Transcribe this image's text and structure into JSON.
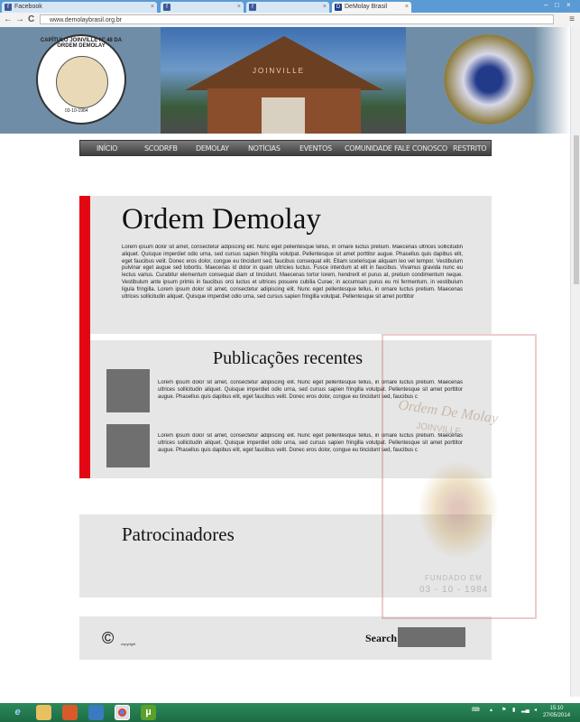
{
  "browser": {
    "tabs": [
      {
        "label": "Facebook",
        "favicon": "f"
      },
      {
        "label": "",
        "favicon": "f"
      },
      {
        "label": "",
        "favicon": "f"
      },
      {
        "label": "DeMolay Brasil",
        "favicon": "D"
      }
    ],
    "url": "www.demolaybrasil.org.br",
    "back": "←",
    "forward": "→",
    "reload": "C",
    "menu": "≡",
    "min": "–",
    "max": "□",
    "close": "×"
  },
  "banner": {
    "seal_text": "CAPÍTULO JOINVILLE Nº 48 DA ORDEM DEMOLAY",
    "seal_date": "03-10-1984",
    "gate_sign": "JOINVILLE"
  },
  "nav": {
    "items": [
      "INÍCIO",
      "SCODRFB",
      "DEMOLAY",
      "NOTÍCIAS",
      "EVENTOS",
      "COMUNIDADE",
      "FALE CONOSCO",
      "RESTRITO"
    ]
  },
  "main": {
    "title": "Ordem Demolay",
    "body": "Lorem ipsum dolor sit amet, consectetur adipiscing elit. Nunc eget pellentesque tellus, in ornare luctus pretium. Maecenas ultrices sollicitudin aliquet. Quisque imperdiet odio urna, sed cursus sapien fringilla volutpat. Pellentesque sit amet porttitor augue. Phasellus quis dapibus elit, eget faucibus velit. Donec eros dolor, congue eu tincidunt sed, faucibus consequat elit. Etiam scelerisque aliquam leo vel tempor. Vestibulum pulvinar eget augue sed lobortis. Maecenas id dolor in quam ultricies luctus. Fusce interdum at elit in faucibus. Vivamus gravida nunc eu lectus varius. Curabitur elementum consequat diam ut tincidunt. Maecenas tortor lorem, hendrerit et purus at, pretium condimentum neque. Vestibulum ante ipsum primis in faucibus orci luctus et ultrices posuere cubilia Curae; in accumsan purus eu mi fermentum, in vestibulum ligula fringilla. Lorem ipsum dolor sit amet, consectetur adipiscing elit. Nunc eget pellentesque tellus, in ornare luctus pretium. Maecenas ultrices sollicitudin aliquet. Quisque imperdiet odio urna, sed cursus sapien fringilla volutpat. Pellentesque sit amet porttitor"
  },
  "recent": {
    "title": "Publicações recentes",
    "posts": [
      {
        "text": "Lorem ipsum dolor sit amet, consectetur adipiscing elit. Nunc eget pellentesque tellus, in ornare luctus pretium. Maecenas ultrices sollicitudin aliquet. Quisque imperdiet odio urna, sed cursus sapien fringilla volutpat. Pellentesque sit amet porttitor augue. Phasellus quis dapibus elit, eget faucibus velit. Donec eros dolor, congue eu tincidunt sed, faucibus c"
      },
      {
        "text": "Lorem ipsum dolor sit amet, consectetur adipiscing elit. Nunc eget pellentesque tellus, in ornare luctus pretium. Maecenas ultrices sollicitudin aliquet. Quisque imperdiet odio urna, sed cursus sapien fringilla volutpat. Pellentesque sit amet porttitor augue. Phasellus quis dapibus elit, eget faucibus velit. Donec eros dolor, congue eu tincidunt sed, faucibus c"
      }
    ]
  },
  "sponsors": {
    "title": "Patrocinadores"
  },
  "footer": {
    "copyright_symbol": "©",
    "copyright": "copyright",
    "search_label": "Search"
  },
  "watermark": {
    "title": "Ordem De Molay",
    "subtitle": "JOINVILLE",
    "founded": "FUNDADO EM",
    "date": "03 - 10 - 1984"
  },
  "taskbar": {
    "time": "15:10",
    "date": "27/05/2014"
  },
  "colors": {
    "accent": "#e30613",
    "panel": "#e6e6e6",
    "taskbar": "#1d6b45"
  }
}
